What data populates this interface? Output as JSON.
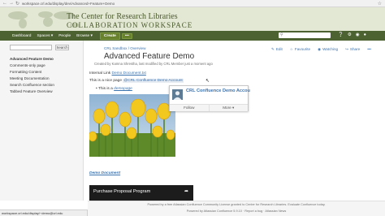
{
  "browser": {
    "url": "workspace.crl.edu/display/dev/Advanced+Feature+Demo"
  },
  "banner": {
    "title_line1": "The Center for Research Libraries",
    "title_line2": "COLLABORATION WORKSPACE"
  },
  "header": {
    "nav": [
      "Dashboard",
      "Spaces ▾",
      "People",
      "Browse ▾"
    ],
    "create_label": "Create",
    "more_label": "•••"
  },
  "sidebar": {
    "search_button": "Search",
    "items": [
      "Advanced Feature Demo",
      "Comments-only page",
      "Formatting Content",
      "Meeting Documentation",
      "Search Confluence section",
      "Tabbed Feature Overview"
    ]
  },
  "page": {
    "breadcrumb": "CRL Sandbox / Overview",
    "actions": [
      {
        "icon": "✎",
        "label": "Edit"
      },
      {
        "icon": "☆",
        "label": "Favourite"
      },
      {
        "icon": "◉",
        "label": "Watching"
      },
      {
        "icon": "↪",
        "label": "Share"
      },
      {
        "icon": "•••",
        "label": ""
      }
    ],
    "title": "Advanced Feature Demo",
    "meta": "Created by Kamna Shrestha, last modified by CRL Member just a moment ago",
    "internal_link_prefix": "Internal Link",
    "internal_link_text": "Demo Document.txt",
    "nice_page_prefix": "This is a nice page",
    "mention": "@CRL Confluence Demo Account",
    "bullet_prefix": "This is a",
    "bullet_emphasis": "demopage",
    "demo_document_link": "Demo Document",
    "video_title": "Purchase Proposal Program",
    "video_share_icon": "➦"
  },
  "hover_card": {
    "name": "CRL Confluence Demo Accou",
    "follow_label": "Follow",
    "more_label": "More ▾"
  },
  "footer": {
    "line1": "Powered by a free Atlassian Confluence Community License granted to Center for Research Libraries. Evaluate Confluence today.",
    "line2": "Powered by Atlassian Confluence 5.9.10  ·  Report a bug  ·  Atlassian News"
  },
  "status_url": "workspace.crl.edu/display/~demo@crl.edu",
  "colors": {
    "header_bg": "#4c6231",
    "banner_bg": "#e3e8d4",
    "link": "#3b73af"
  }
}
